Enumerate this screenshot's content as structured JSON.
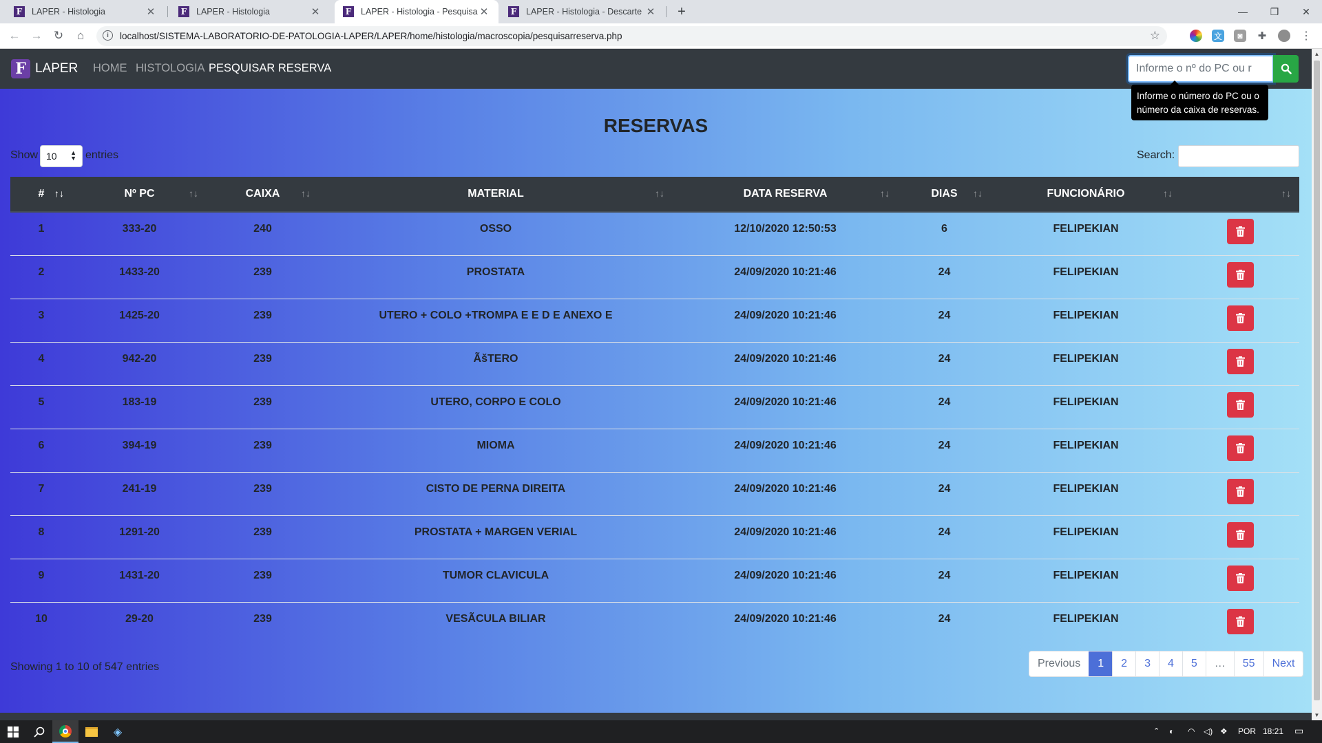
{
  "browser": {
    "tabs": [
      {
        "title": "LAPER - Histologia"
      },
      {
        "title": "LAPER - Histologia"
      },
      {
        "title": "LAPER - Histologia - Pesquisar Re"
      },
      {
        "title": "LAPER - Histologia - Descarte"
      }
    ],
    "active_tab": 2,
    "url": "localhost/SISTEMA-LABORATORIO-DE-PATOLOGIA-LAPER/LAPER/home/histologia/macroscopia/pesquisarreserva.php"
  },
  "navbar": {
    "logo_letter": "F",
    "brand": "LAPER",
    "links": [
      {
        "label": "HOME"
      },
      {
        "label": "HISTOLOGIA"
      },
      {
        "label": "PESQUISAR RESERVA"
      }
    ],
    "search_placeholder": "Informe o nº do PC ou r",
    "tooltip_line1": "Informe o número do PC ou o",
    "tooltip_line2": "número da caixa de reservas."
  },
  "page": {
    "title": "RESERVAS",
    "length_show": "Show",
    "length_value": "10",
    "length_entries": "entries",
    "search_label": "Search:"
  },
  "table": {
    "columns": [
      "#",
      "Nº PC",
      "CAIXA",
      "MATERIAL",
      "DATA RESERVA",
      "DIAS",
      "FUNCIONÁRIO",
      ""
    ],
    "rows": [
      {
        "num": "1",
        "pc": "333-20",
        "caixa": "240",
        "material": "OSSO",
        "data": "12/10/2020 12:50:53",
        "dias": "6",
        "funcionario": "FELIPEKIAN"
      },
      {
        "num": "2",
        "pc": "1433-20",
        "caixa": "239",
        "material": "PROSTATA",
        "data": "24/09/2020 10:21:46",
        "dias": "24",
        "funcionario": "FELIPEKIAN"
      },
      {
        "num": "3",
        "pc": "1425-20",
        "caixa": "239",
        "material": "UTERO + COLO +TROMPA E E D E ANEXO E",
        "data": "24/09/2020 10:21:46",
        "dias": "24",
        "funcionario": "FELIPEKIAN"
      },
      {
        "num": "4",
        "pc": "942-20",
        "caixa": "239",
        "material": "ÃšTERO",
        "data": "24/09/2020 10:21:46",
        "dias": "24",
        "funcionario": "FELIPEKIAN"
      },
      {
        "num": "5",
        "pc": "183-19",
        "caixa": "239",
        "material": "UTERO, CORPO E COLO",
        "data": "24/09/2020 10:21:46",
        "dias": "24",
        "funcionario": "FELIPEKIAN"
      },
      {
        "num": "6",
        "pc": "394-19",
        "caixa": "239",
        "material": "MIOMA",
        "data": "24/09/2020 10:21:46",
        "dias": "24",
        "funcionario": "FELIPEKIAN"
      },
      {
        "num": "7",
        "pc": "241-19",
        "caixa": "239",
        "material": "CISTO DE PERNA DIREITA",
        "data": "24/09/2020 10:21:46",
        "dias": "24",
        "funcionario": "FELIPEKIAN"
      },
      {
        "num": "8",
        "pc": "1291-20",
        "caixa": "239",
        "material": "PROSTATA + MARGEN VERIAL",
        "data": "24/09/2020 10:21:46",
        "dias": "24",
        "funcionario": "FELIPEKIAN"
      },
      {
        "num": "9",
        "pc": "1431-20",
        "caixa": "239",
        "material": "TUMOR CLAVICULA",
        "data": "24/09/2020 10:21:46",
        "dias": "24",
        "funcionario": "FELIPEKIAN"
      },
      {
        "num": "10",
        "pc": "29-20",
        "caixa": "239",
        "material": "VESÃCULA BILIAR",
        "data": "24/09/2020 10:21:46",
        "dias": "24",
        "funcionario": "FELIPEKIAN"
      }
    ]
  },
  "footer": {
    "info": "Showing 1 to 10 of 547 entries",
    "pages": [
      "Previous",
      "1",
      "2",
      "3",
      "4",
      "5",
      "…",
      "55",
      "Next"
    ],
    "active_page": "1"
  },
  "taskbar": {
    "lang": "POR",
    "time": "18:21"
  },
  "colors": {
    "navbar": "#343a40",
    "search_button": "#28a745",
    "delete_button": "#dc3545",
    "pagination_active": "#4c6fd8"
  }
}
